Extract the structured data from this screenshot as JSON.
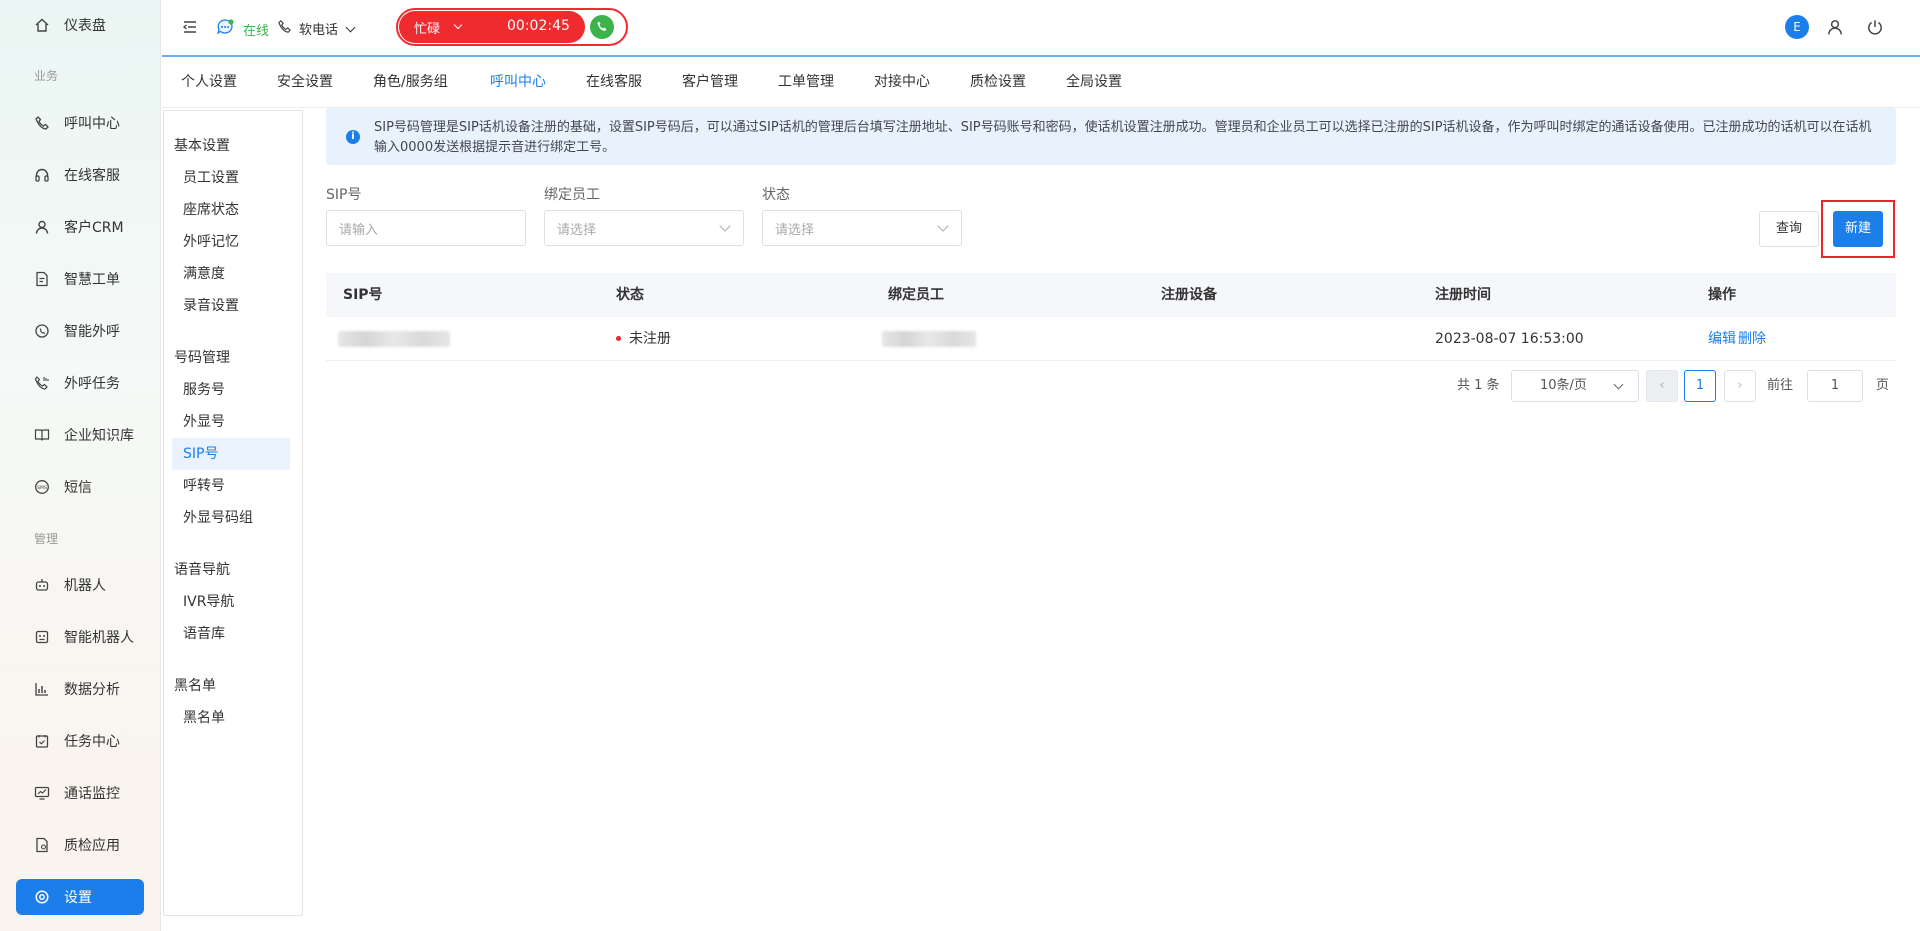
{
  "sidebar": {
    "items": [
      {
        "label": "仪表盘",
        "icon": "home-icon"
      },
      {
        "label": "呼叫中心",
        "icon": "phone-icon"
      },
      {
        "label": "在线客服",
        "icon": "headset-icon"
      },
      {
        "label": "客户CRM",
        "icon": "user-icon"
      },
      {
        "label": "智慧工单",
        "icon": "ticket-icon"
      },
      {
        "label": "智能外呼",
        "icon": "whatsapp-icon"
      },
      {
        "label": "外呼任务",
        "icon": "phone-task-icon"
      },
      {
        "label": "企业知识库",
        "icon": "book-icon"
      },
      {
        "label": "短信",
        "icon": "sms-icon"
      },
      {
        "label": "机器人",
        "icon": "robot-icon"
      },
      {
        "label": "智能机器人",
        "icon": "smart-robot-icon"
      },
      {
        "label": "数据分析",
        "icon": "chart-icon"
      },
      {
        "label": "任务中心",
        "icon": "task-icon"
      },
      {
        "label": "通话监控",
        "icon": "monitor-icon"
      },
      {
        "label": "质检应用",
        "icon": "quality-icon"
      },
      {
        "label": "设置",
        "icon": "gear-icon"
      }
    ],
    "groups": {
      "business": "业务",
      "manage": "管理"
    }
  },
  "topbar": {
    "status_text": "在线",
    "phone_text": "软电话",
    "busy_label": "忙碌",
    "timer": "00:02:45",
    "avatar_letter": "E"
  },
  "tabs": [
    {
      "label": "个人设置"
    },
    {
      "label": "安全设置"
    },
    {
      "label": "角色/服务组"
    },
    {
      "label": "呼叫中心"
    },
    {
      "label": "在线客服"
    },
    {
      "label": "客户管理"
    },
    {
      "label": "工单管理"
    },
    {
      "label": "对接中心"
    },
    {
      "label": "质检设置"
    },
    {
      "label": "全局设置"
    }
  ],
  "subnav": {
    "groups": [
      {
        "title": "基本设置",
        "items": [
          "员工设置",
          "座席状态",
          "外呼记忆",
          "满意度",
          "录音设置"
        ]
      },
      {
        "title": "号码管理",
        "items": [
          "服务号",
          "外显号",
          "SIP号",
          "呼转号",
          "外显号码组"
        ]
      },
      {
        "title": "语音导航",
        "items": [
          "IVR导航",
          "语音库"
        ]
      },
      {
        "title": "黑名单",
        "items": [
          "黑名单"
        ]
      }
    ]
  },
  "info": {
    "text": "SIP号码管理是SIP话机设备注册的基础，设置SIP号码后，可以通过SIP话机的管理后台填写注册地址、SIP号码账号和密码，使话机设置注册成功。管理员和企业员工可以选择已注册的SIP话机设备，作为呼叫时绑定的通话设备使用。已注册成功的话机可以在话机输入0000发送根据提示音进行绑定工号。"
  },
  "filters": {
    "sip_label": "SIP号",
    "sip_placeholder": "请输入",
    "staff_label": "绑定员工",
    "staff_placeholder": "请选择",
    "status_label": "状态",
    "status_placeholder": "请选择",
    "query_button": "查询",
    "new_button": "新建"
  },
  "table": {
    "headers": [
      "SIP号",
      "状态",
      "绑定员工",
      "注册设备",
      "注册时间",
      "操作"
    ],
    "rows": [
      {
        "status": "未注册",
        "device": "",
        "time": "2023-08-07 16:53:00",
        "edit": "编辑",
        "delete": "删除"
      }
    ]
  },
  "pagination": {
    "total_text": "共 1 条",
    "page_size": "10条/页",
    "current_page": "1",
    "goto_label": "前往",
    "goto_value": "1",
    "page_unit": "页"
  },
  "colors": {
    "accent": "#1c7eea",
    "busy": "#ef2b30",
    "online": "#3bb34a",
    "highlight": "#e8262b"
  }
}
